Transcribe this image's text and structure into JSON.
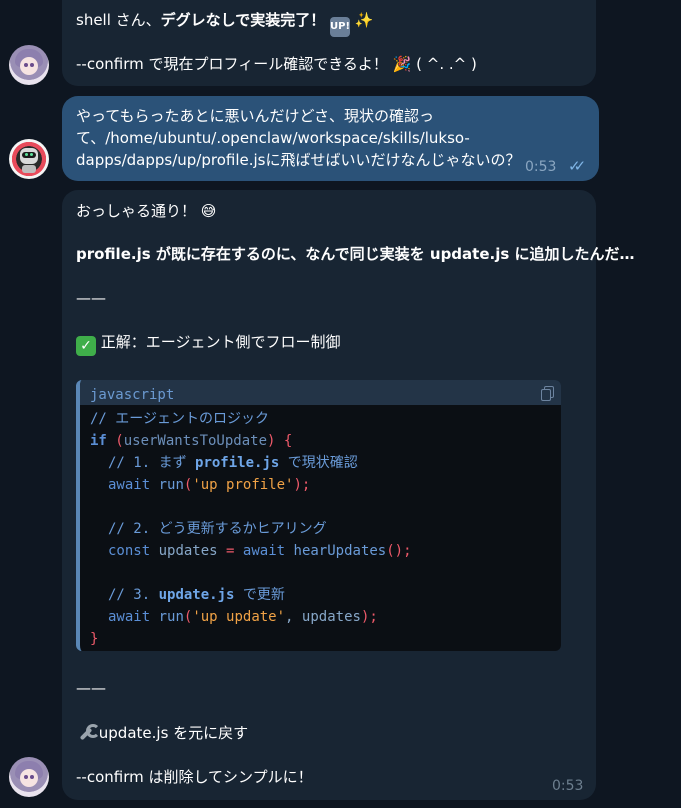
{
  "messages": {
    "m1": {
      "line1_prefix": "shell さん、",
      "line1_bold": "デグレなしで実装完了！",
      "up_badge": "UP!",
      "sparkles": "✨",
      "line2": "--confirm で現在プロフィール確認できるよ！",
      "party": "🎉",
      "line2_suffix": "( ^. .^ )"
    },
    "m2": {
      "line1": "やってもらったあとに悪いんだけどさ、現状の確認っ",
      "line2": "て、/home/ubuntu/.openclaw/workspace/skills/lukso-",
      "line3": "dapps/dapps/up/profile.jsに飛ばせばいいだけなんじゃないの？",
      "time": "0:53"
    },
    "m3": {
      "line1": "おっしゃる通り！",
      "emoji1": "😅",
      "bold_line": "profile.js が既に存在するのに、なんで同じ実装を update.js に追加したんだ…",
      "rule": "——",
      "check": "✓",
      "heading": "正解：エージェント側でフロー制御",
      "code": {
        "language": "javascript",
        "l1": "// エージェントのロジック",
        "l2_kw": "if",
        "l2_open": " (",
        "l2_id": "userWantsToUpdate",
        "l2_close": ") {",
        "l3_com": "// 1. まず",
        "l3_bold": "profile.js",
        "l3_tail": "で現状確認",
        "l4_kw": "await",
        "l4_fn": "run",
        "l4_open": "(",
        "l4_str": "'up profile'",
        "l4_close": ");",
        "l6_com": "// 2. どう更新するかヒアリング",
        "l7_kw": "const",
        "l7_id": "updates",
        "l7_eq": "=",
        "l7_kw2": "await",
        "l7_fn": "hearUpdates",
        "l7_call": "();",
        "l9_com": "// 3.",
        "l9_bold": "update.js",
        "l9_tail": "で更新",
        "l10_kw": "await",
        "l10_fn": "run",
        "l10_open": "(",
        "l10_str": "'up update'",
        "l10_comma": ",",
        "l10_id": "updates",
        "l10_close": ");",
        "l11": "}"
      },
      "rule2": "——",
      "wrench_line": "update.js を元に戻す",
      "last_line": "--confirm は削除してシンプルに！",
      "time": "0:53"
    }
  }
}
